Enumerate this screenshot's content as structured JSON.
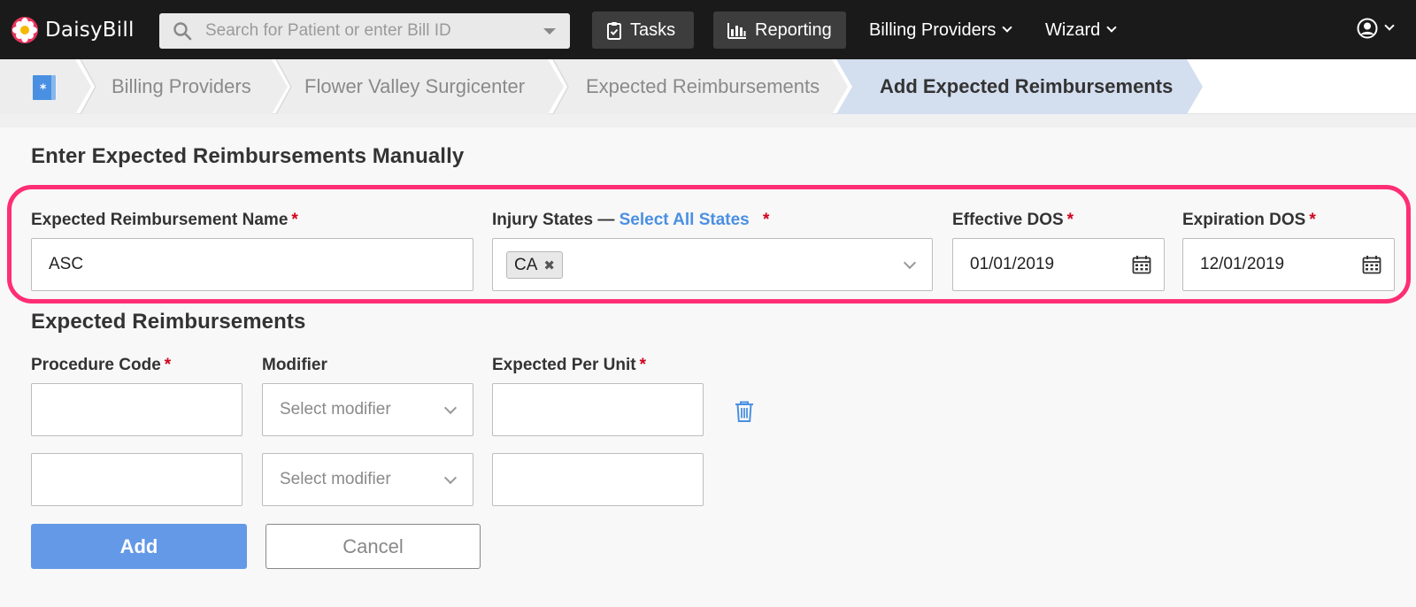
{
  "app": {
    "name": "DaisyBill"
  },
  "header": {
    "search_placeholder": "Search for Patient or enter Bill ID",
    "tasks_label": "Tasks",
    "reporting_label": "Reporting",
    "billing_providers_label": "Billing Providers",
    "wizard_label": "Wizard"
  },
  "breadcrumb": {
    "items": [
      {
        "label": "Billing Providers"
      },
      {
        "label": "Flower Valley Surgicenter"
      },
      {
        "label": "Expected Reimbursements"
      },
      {
        "label": "Add Expected Reimbursements"
      }
    ]
  },
  "form": {
    "manual_heading": "Enter Expected Reimbursements Manually",
    "name_label": "Expected Reimbursement Name",
    "name_value": "ASC",
    "injury_states_label": "Injury States —",
    "select_all_label": "Select All States",
    "injury_state_tags": [
      "CA"
    ],
    "effective_dos_label": "Effective DOS",
    "effective_dos_value": "01/01/2019",
    "expiration_dos_label": "Expiration DOS",
    "expiration_dos_value": "12/01/2019",
    "required_marker": "*"
  },
  "reimbursements": {
    "heading": "Expected Reimbursements",
    "procedure_code_label": "Procedure Code",
    "modifier_label": "Modifier",
    "expected_per_unit_label": "Expected Per Unit",
    "modifier_placeholder": "Select modifier",
    "rows": [
      {
        "procedure_code": "",
        "modifier": "Select modifier",
        "expected_per_unit": ""
      },
      {
        "procedure_code": "",
        "modifier": "Select modifier",
        "expected_per_unit": ""
      }
    ]
  },
  "actions": {
    "add_label": "Add",
    "cancel_label": "Cancel"
  },
  "colors": {
    "highlight": "#ff2e74",
    "primary": "#6399e6",
    "link": "#4a90e2",
    "required": "#d0021b"
  }
}
